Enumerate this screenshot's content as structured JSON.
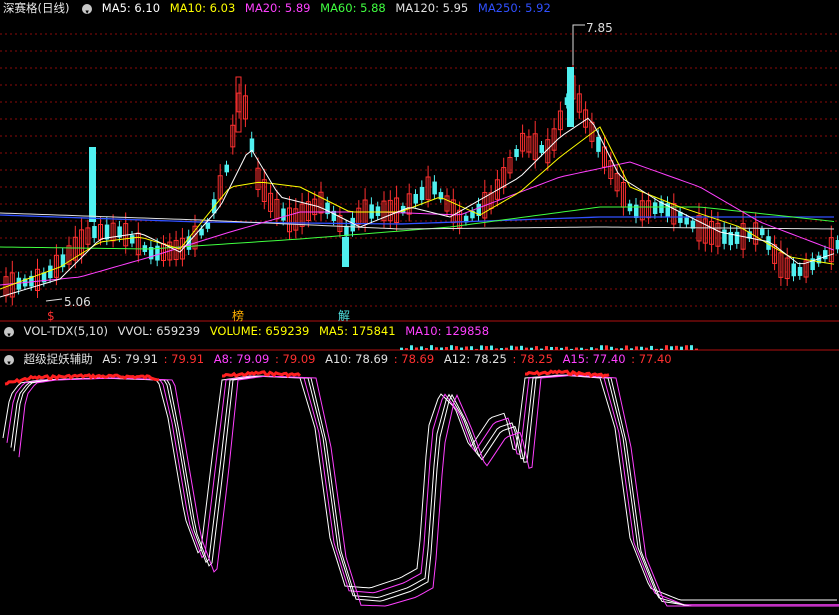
{
  "main": {
    "title": "深赛格(日线)",
    "ma": [
      {
        "label": "MA5: 6.10",
        "color": "#ffffff"
      },
      {
        "label": "MA10: 6.03",
        "color": "#ffff00"
      },
      {
        "label": "MA20: 5.89",
        "color": "#ff40ff"
      },
      {
        "label": "MA60: 5.88",
        "color": "#40ff40"
      },
      {
        "label": "MA120: 5.95",
        "color": "#e0e0e0"
      },
      {
        "label": "MA250: 5.92",
        "color": "#3050ff"
      }
    ],
    "high_label": "7.85",
    "low_label": "5.06",
    "markers": [
      {
        "text": "$",
        "color": "#ff3030"
      },
      {
        "text": "榜",
        "color": "#ffb000"
      },
      {
        "text": "解",
        "color": "#50e0e0"
      }
    ]
  },
  "volume": {
    "title": "VOL-TDX(5,10)",
    "items": [
      {
        "label": "VVOL: 659239",
        "color": "#e0e0e0"
      },
      {
        "label": "VOLUME: 659239",
        "color": "#ffff00"
      },
      {
        "label": "MA5: 175841",
        "color": "#ffff00"
      },
      {
        "label": "MA10: 129858",
        "color": "#ff40ff"
      }
    ]
  },
  "indicator": {
    "title": "超级捉妖辅助",
    "items": [
      {
        "label": "A5: 79.91",
        "color": "#e0e0e0"
      },
      {
        "label": ": 79.91",
        "color": "#ff3030"
      },
      {
        "label": "A8: 79.09",
        "color": "#ff40ff"
      },
      {
        "label": ": 79.09",
        "color": "#ff3030"
      },
      {
        "label": "A10: 78.69",
        "color": "#e0e0e0"
      },
      {
        "label": ": 78.69",
        "color": "#ff3030"
      },
      {
        "label": "A12: 78.25",
        "color": "#e0e0e0"
      },
      {
        "label": ": 78.25",
        "color": "#ff3030"
      },
      {
        "label": "A15: 77.40",
        "color": "#ff40ff"
      },
      {
        "label": ": 77.40",
        "color": "#ff3030"
      }
    ]
  },
  "colors": {
    "up": "#ff3030",
    "down": "#50f0f0",
    "grid": "#a01010",
    "bg": "#000000"
  }
}
